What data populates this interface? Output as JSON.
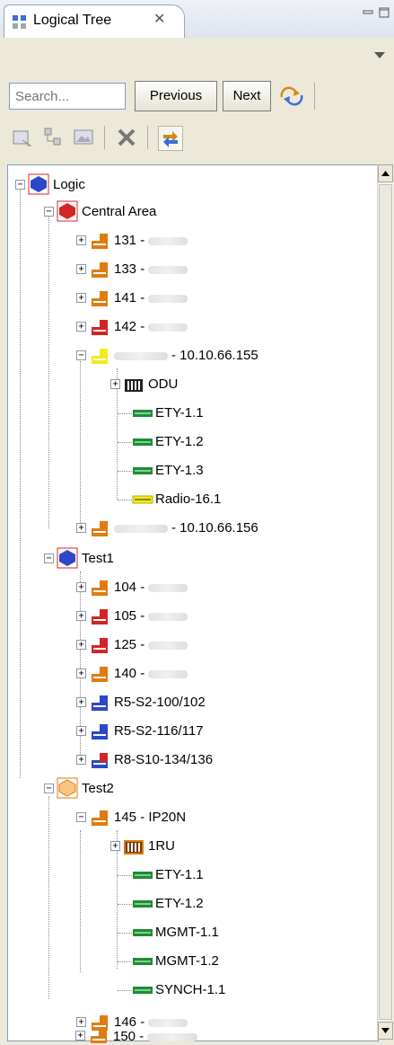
{
  "view": {
    "tab_title": "Logical Tree",
    "tab_close": "✕"
  },
  "toolbar": {
    "search_placeholder": "Search...",
    "previous_label": "Previous",
    "next_label": "Next"
  },
  "tree": {
    "root": "Logic",
    "central_area": "Central Area",
    "ca_131": "131 -",
    "ca_133": "133 -",
    "ca_141": "141 -",
    "ca_142": "142 -",
    "ca_ip": "- 10.10.66.155",
    "odu": "ODU",
    "ety11": "ETY-1.1",
    "ety12": "ETY-1.2",
    "ety13": "ETY-1.3",
    "radio": "Radio-16.1",
    "ca_ip2": "- 10.10.66.156",
    "test1": "Test1",
    "t1_104": "104 -",
    "t1_105": "105 -",
    "t1_125": "125 -",
    "t1_140": "140 -",
    "r5_100": "R5-S2-100/102",
    "r5_116": "R5-S2-116/117",
    "r8_134": "R8-S10-134/136",
    "test2": "Test2",
    "t2_145": "145 - IP20N",
    "ru1": "1RU",
    "t2_ety11": "ETY-1.1",
    "t2_ety12": "ETY-1.2",
    "mgmt11": "MGMT-1.1",
    "mgmt12": "MGMT-1.2",
    "synch11": "SYNCH-1.1",
    "t2_146": "146 -",
    "t2_150": "150 -"
  },
  "colors": {
    "orange": "#e07b10",
    "red": "#d42424",
    "yellow": "#f2ea1a",
    "blue": "#2c47c8",
    "green": "#1f8a3a"
  }
}
